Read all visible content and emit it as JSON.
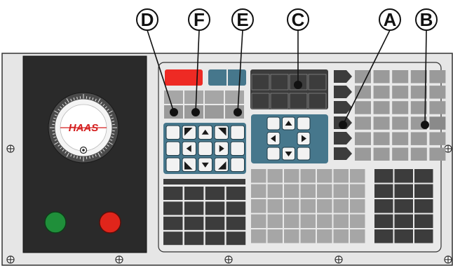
{
  "diagram": {
    "callouts": [
      {
        "id": "D",
        "label": "D"
      },
      {
        "id": "F",
        "label": "F"
      },
      {
        "id": "E",
        "label": "E"
      },
      {
        "id": "C",
        "label": "C"
      },
      {
        "id": "A",
        "label": "A"
      },
      {
        "id": "B",
        "label": "B"
      }
    ],
    "handwheel_brand": "HAAS",
    "colors": {
      "panel_fill": "#e6e6e6",
      "pendant_dark": "#2a2a2a",
      "key_dark": "#3c3c3c",
      "key_grey": "#9a9a9a",
      "key_light": "#a6a6a6",
      "key_blue": "#46778c",
      "key_red": "#ee2a24",
      "cycle_start_green": "#1f8f3a",
      "feed_hold_red": "#e0251b",
      "brand_red": "#d41e1e"
    }
  }
}
